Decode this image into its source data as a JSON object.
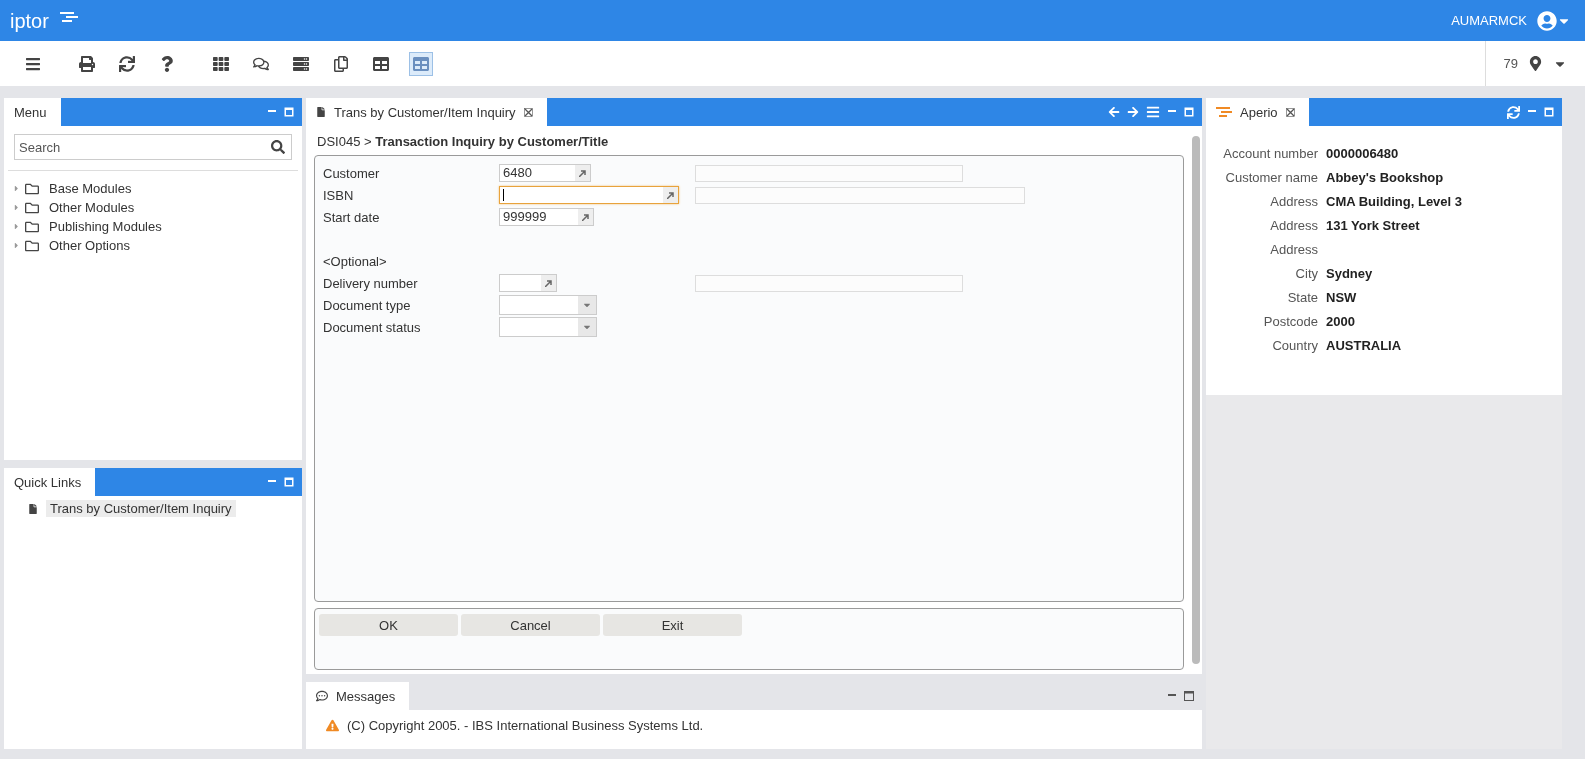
{
  "header": {
    "logo": "iptor",
    "user": "AUMARMCK"
  },
  "toolbar": {
    "counter": "79",
    "items": [
      {
        "kind": "menu",
        "selected": false
      },
      {
        "kind": "print",
        "selected": false
      },
      {
        "kind": "refresh",
        "selected": false
      },
      {
        "kind": "help",
        "selected": false
      },
      {
        "kind": "grid",
        "selected": false
      },
      {
        "kind": "chat",
        "selected": false
      },
      {
        "kind": "server",
        "selected": false
      },
      {
        "kind": "copy",
        "selected": false
      },
      {
        "kind": "table",
        "selected": false
      },
      {
        "kind": "sheet",
        "selected": true
      }
    ]
  },
  "menu_panel": {
    "title": "Menu",
    "search": {
      "placeholder": "Search"
    },
    "items": [
      {
        "label": "Base Modules",
        "expanded": false
      },
      {
        "label": "Other Modules",
        "expanded": false
      },
      {
        "label": "Publishing Modules",
        "expanded": false
      },
      {
        "label": "Other Options",
        "expanded": false
      }
    ]
  },
  "quick_links": {
    "title": "Quick Links",
    "items": [
      {
        "label": "Trans by Customer/Item Inquiry",
        "selected": true
      }
    ]
  },
  "main_panel": {
    "tab": "Trans by Customer/Item Inquiry",
    "breadcrumb": "DSI045 > **Transaction Inquiry by Customer/Title**",
    "fields": [
      {
        "kind": "lookup",
        "label": "Customer",
        "value": "6480",
        "focused": false,
        "description": true
      },
      {
        "kind": "lookup",
        "label": "ISBN",
        "focused": true,
        "description": true
      },
      {
        "kind": "lookup",
        "label": "Start date",
        "value": "999999",
        "focused": false,
        "description": false
      },
      {
        "kind": "section",
        "label": "<Optional>"
      },
      {
        "kind": "lookup",
        "label": "Delivery number",
        "focused": false,
        "description": true
      },
      {
        "kind": "dropdown",
        "label": "Document type"
      },
      {
        "kind": "dropdown",
        "label": "Document status"
      }
    ],
    "buttons": [
      "OK",
      "Cancel",
      "Exit"
    ]
  },
  "messages": {
    "tab": "Messages",
    "items": [
      {
        "kind": "warning",
        "text": "(C) Copyright 2005. - IBS International Business Systems Ltd."
      }
    ]
  },
  "aperio": {
    "tab": "Aperio",
    "rows": [
      {
        "label": "Account number",
        "value": "0000006480"
      },
      {
        "label": "Customer name",
        "value": "Abbey's Bookshop"
      },
      {
        "label": "Address",
        "value": "CMA Building, Level 3"
      },
      {
        "label": "Address",
        "value": "131 York Street"
      },
      {
        "label": "Address"
      },
      {
        "label": "City",
        "value": "Sydney"
      },
      {
        "label": "State",
        "value": "NSW"
      },
      {
        "label": "Postcode",
        "value": "2000"
      },
      {
        "label": "Country",
        "value": "AUSTRALIA"
      }
    ]
  }
}
